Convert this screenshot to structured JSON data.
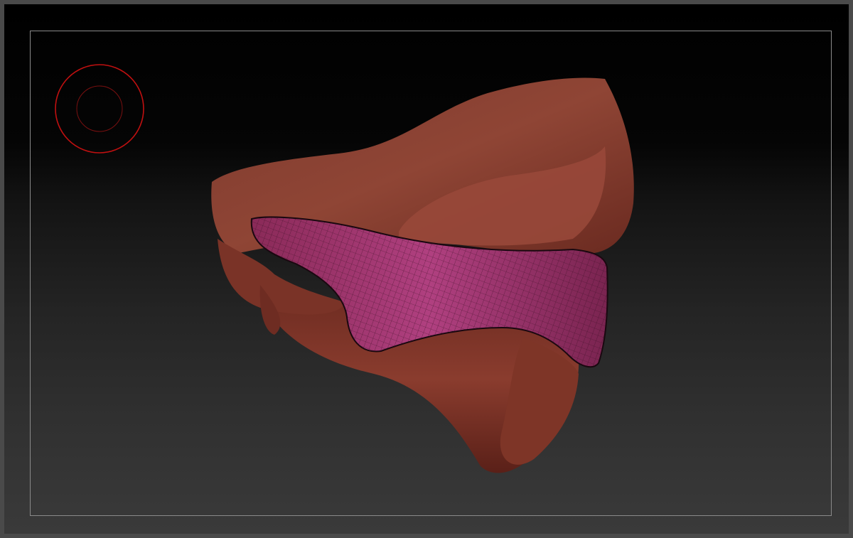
{
  "viewport": {
    "background_top": "#000000",
    "background_bottom": "#3a3a3a",
    "frame_line_color": "#8a8a8a"
  },
  "brush_cursor": {
    "icon": "brush-radius-cursor-icon",
    "color": "#c01010"
  },
  "model": {
    "description_icon": "sculpt-mesh",
    "skin_color": "#8a3a2c",
    "mask_color": "#a0306a"
  }
}
